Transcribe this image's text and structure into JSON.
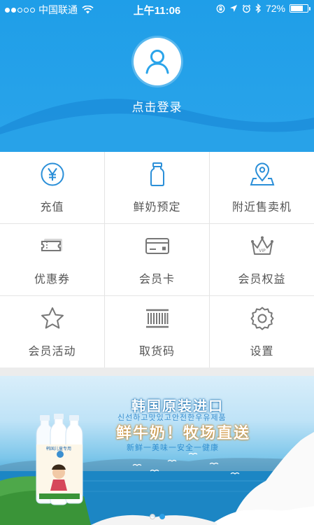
{
  "status_bar": {
    "carrier": "中国联通",
    "time": "上午11:06",
    "battery": "72%",
    "battery_level": 0.72,
    "signal_bars_on": 2,
    "signal_bars_total": 5
  },
  "header": {
    "login_label": "点击登录"
  },
  "grid": {
    "items": [
      {
        "label": "充值",
        "icon": "yen-icon"
      },
      {
        "label": "鲜奶预定",
        "icon": "milk-bottle-icon"
      },
      {
        "label": "附近售卖机",
        "icon": "location-pin-icon"
      },
      {
        "label": "优惠券",
        "icon": "coupon-icon"
      },
      {
        "label": "会员卡",
        "icon": "card-icon"
      },
      {
        "label": "会员权益",
        "icon": "vip-crown-icon"
      },
      {
        "label": "会员活动",
        "icon": "star-icon"
      },
      {
        "label": "取货码",
        "icon": "barcode-icon"
      },
      {
        "label": "设置",
        "icon": "gear-icon"
      }
    ]
  },
  "banner": {
    "title": "韩国原装进口",
    "korean_line": "신선하고맛있고안전한우유제품",
    "slogan": "鲜牛奶！牧场直送",
    "subline": "新鲜一美味一安全一健康",
    "bottle_label": "韩国儿童专用",
    "slides_total": 2,
    "active_slide": 2
  },
  "colors": {
    "primary": "#2aa4ea",
    "icon_blue": "#2b8fd8",
    "icon_gray": "#666666"
  }
}
